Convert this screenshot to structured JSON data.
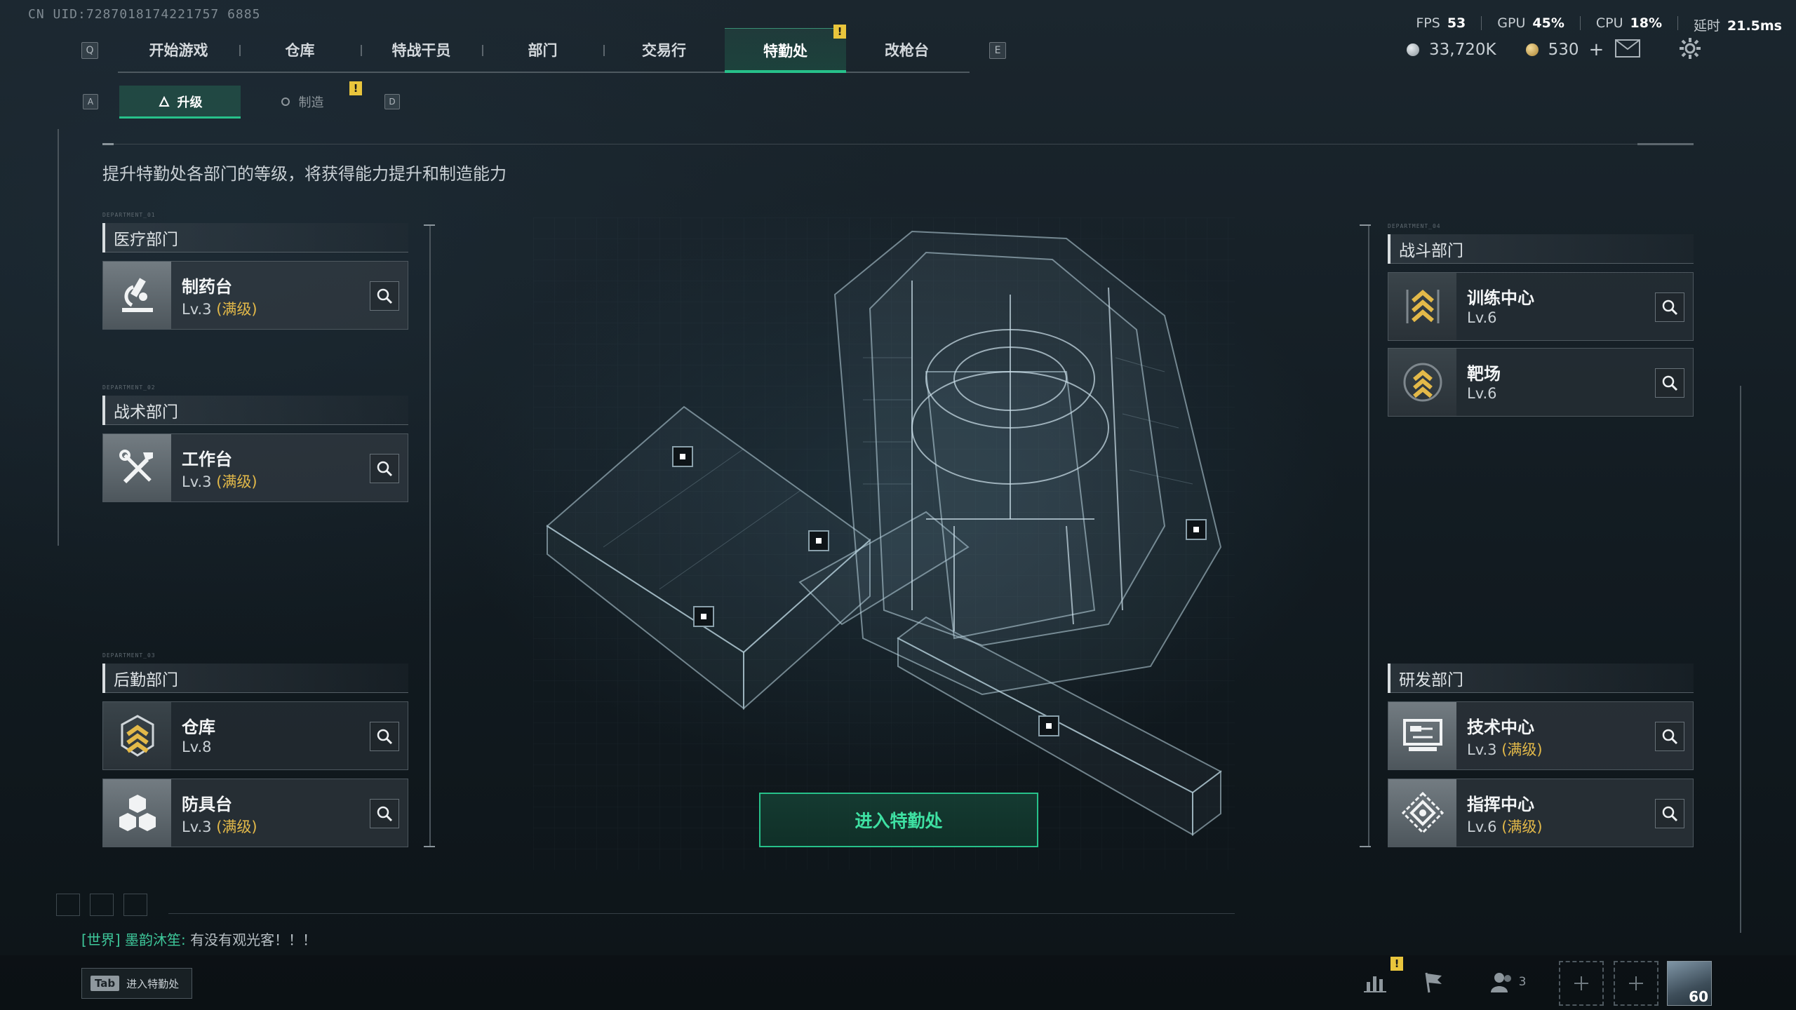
{
  "uid": "CN UID:7287018174221757 6885",
  "nav": {
    "key_left": "Q",
    "key_right": "E",
    "tabs": [
      {
        "label": "开始游戏"
      },
      {
        "label": "仓库"
      },
      {
        "label": "特战干员"
      },
      {
        "label": "部门"
      },
      {
        "label": "交易行"
      },
      {
        "label": "特勤处",
        "active": true,
        "badge": "!"
      },
      {
        "label": "改枪台"
      }
    ]
  },
  "stats": {
    "fps_label": "FPS",
    "fps": "53",
    "gpu_label": "GPU",
    "gpu": "45%",
    "cpu_label": "CPU",
    "cpu": "18%",
    "latency_label": "延时",
    "latency": "21.5ms"
  },
  "currency": {
    "silver": "33,720K",
    "gold": "530",
    "add": "+"
  },
  "sub_nav": {
    "key_left": "A",
    "key_right": "D",
    "tabs": [
      {
        "label": "升级",
        "active": true
      },
      {
        "label": "制造",
        "badge": "!"
      }
    ]
  },
  "description": "提升特勤处各部门的等级，将获得能力提升和制造能力",
  "departments": {
    "medical": {
      "tag": "DEPARTMENT_01",
      "title": "医疗部门",
      "facilities": [
        {
          "name": "制药台",
          "level": "Lv.3",
          "max": "(满级)",
          "icon": "microscope-icon"
        }
      ]
    },
    "tactical": {
      "tag": "DEPARTMENT_02",
      "title": "战术部门",
      "facilities": [
        {
          "name": "工作台",
          "level": "Lv.3",
          "max": "(满级)",
          "icon": "tools-icon"
        }
      ]
    },
    "logistics": {
      "tag": "DEPARTMENT_03",
      "title": "后勤部门",
      "facilities": [
        {
          "name": "仓库",
          "level": "Lv.8",
          "max": "",
          "icon": "rank-chevron-icon"
        },
        {
          "name": "防具台",
          "level": "Lv.3",
          "max": "(满级)",
          "icon": "cubes-icon"
        }
      ]
    },
    "combat": {
      "tag": "DEPARTMENT_04",
      "title": "战斗部门",
      "facilities": [
        {
          "name": "训练中心",
          "level": "Lv.6",
          "max": "",
          "icon": "rank-chevron-icon"
        },
        {
          "name": "靶场",
          "level": "Lv.6",
          "max": "",
          "icon": "rank-chevron-icon"
        }
      ]
    },
    "research": {
      "tag": "",
      "title": "研发部门",
      "facilities": [
        {
          "name": "技术中心",
          "level": "Lv.3",
          "max": "(满级)",
          "icon": "monitor-icon"
        },
        {
          "name": "指挥中心",
          "level": "Lv.6",
          "max": "(满级)",
          "icon": "command-diamond-icon"
        }
      ]
    }
  },
  "enter_button": "进入特勤处",
  "chat": {
    "channel": "[世界]",
    "sender": "墨韵沐笙:",
    "message": "有没有观光客！！！"
  },
  "tab_hint": {
    "key": "Tab",
    "label": "进入特勤处"
  },
  "bottom": {
    "stats_badge": "!",
    "team_count": "3",
    "avatar_level": "60"
  },
  "colors": {
    "accent_green": "#27c18a",
    "max_level_gold": "#e3b949",
    "warning_yellow": "#e9c53c"
  }
}
